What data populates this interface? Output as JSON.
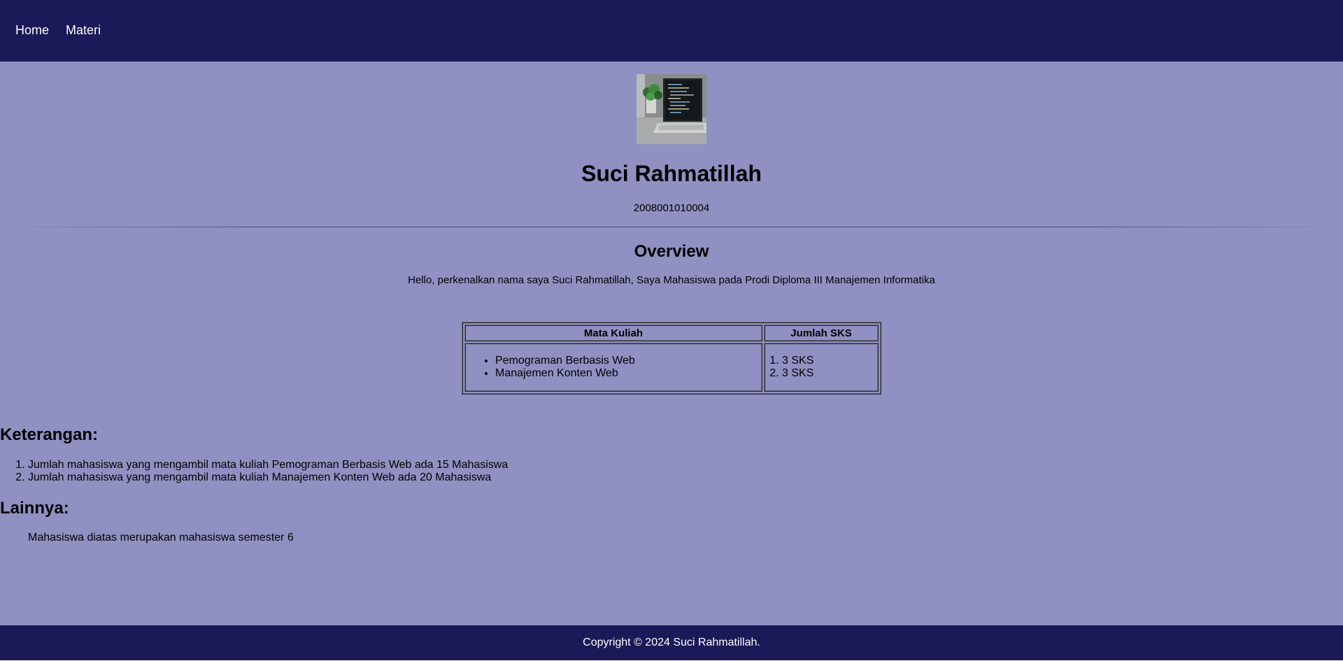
{
  "nav": {
    "items": [
      {
        "label": "Home"
      },
      {
        "label": "Materi"
      }
    ]
  },
  "profile": {
    "name": "Suci Rahmatillah",
    "nim": "2008001010004"
  },
  "overview": {
    "title": "Overview",
    "text": "Hello, perkenalkan nama saya Suci Rahmatillah, Saya Mahasiswa pada Prodi Diploma III Manajemen Informatika"
  },
  "table": {
    "headers": [
      "Mata Kuliah",
      "Jumlah SKS"
    ],
    "courses": [
      "Pemograman Berbasis Web",
      "Manajemen Konten Web"
    ],
    "sks": [
      "3 SKS",
      "3 SKS"
    ]
  },
  "keterangan": {
    "title": "Keterangan:",
    "items": [
      "Jumlah mahasiswa yang mengambil mata kuliah Pemograman Berbasis Web ada 15 Mahasiswa",
      "Jumlah mahasiswa yang mengambil mata kuliah Manajemen Konten Web ada 20 Mahasiswa"
    ]
  },
  "lainnya": {
    "title": "Lainnya:",
    "text": "Mahasiswa diatas merupakan mahasiswa semester 6"
  },
  "footer": {
    "text": "Copyright © 2024 Suci Rahmatillah."
  },
  "colors": {
    "nav_bg": "#1b1958",
    "content_bg": "#9190c2",
    "footer_bg": "#1b1958"
  },
  "icons": {
    "avatar": "laptop-photo"
  }
}
